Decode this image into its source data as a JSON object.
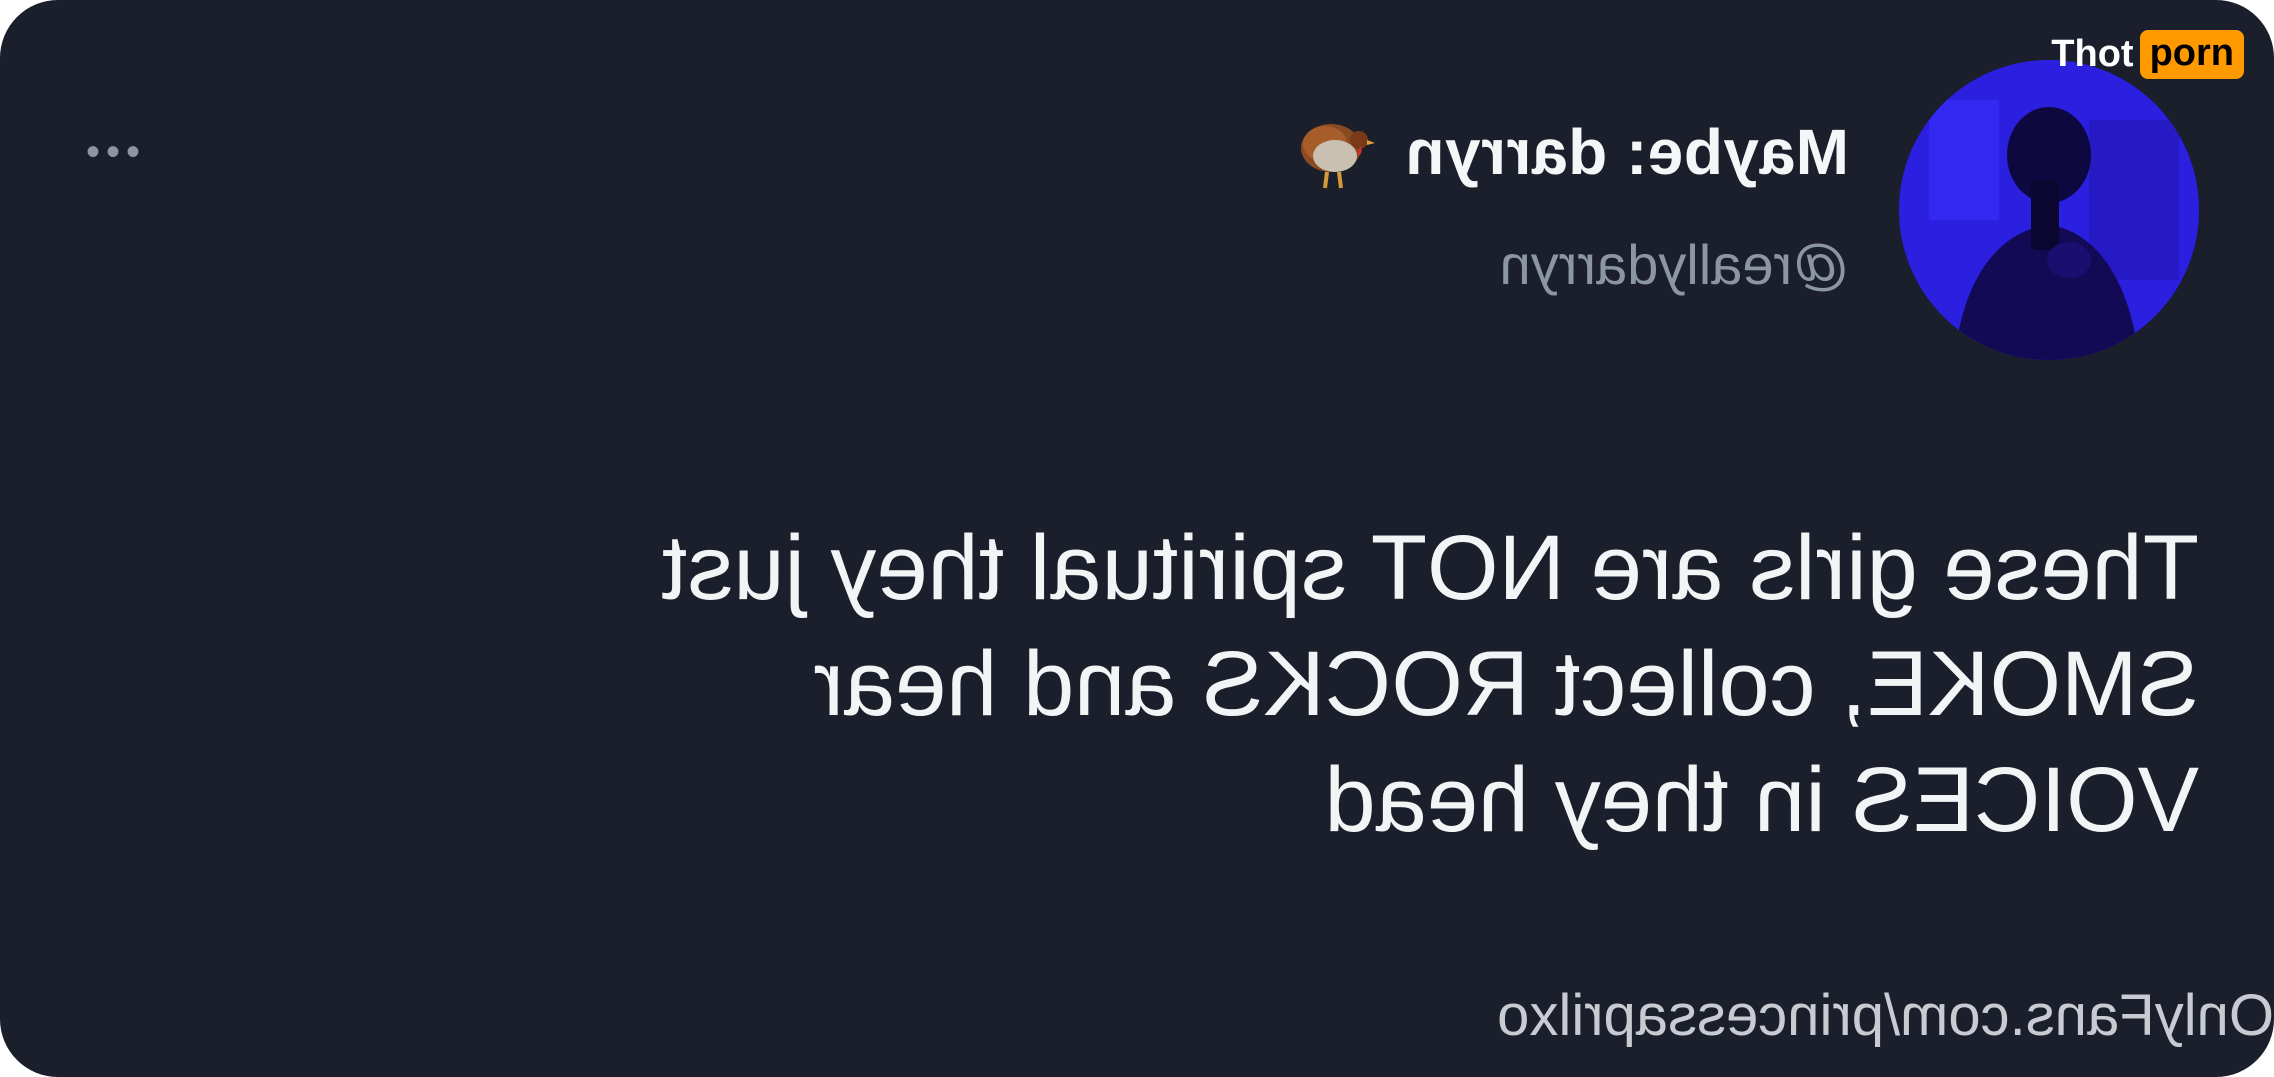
{
  "tweet": {
    "display_name": "Maybe: darryn",
    "name_emoji": "turkey-icon",
    "handle": "@reallydarryn",
    "more_icon": "more-options-icon",
    "text_lines": [
      "These girls are NOT spiritual they just",
      "SMOKE, collect ROCKS and hear",
      "VOICES in they head"
    ],
    "mirrored": true
  },
  "watermark": {
    "text": "OnlyFans.com/princessaprilxo"
  },
  "logo": {
    "part1": "Thot",
    "part2": "porn"
  },
  "colors": {
    "background": "#1a1f2b",
    "text": "#f3f4f6",
    "muted": "#8c96a3",
    "logo_accent": "#ff9900",
    "avatar": "#2a1dd6"
  }
}
